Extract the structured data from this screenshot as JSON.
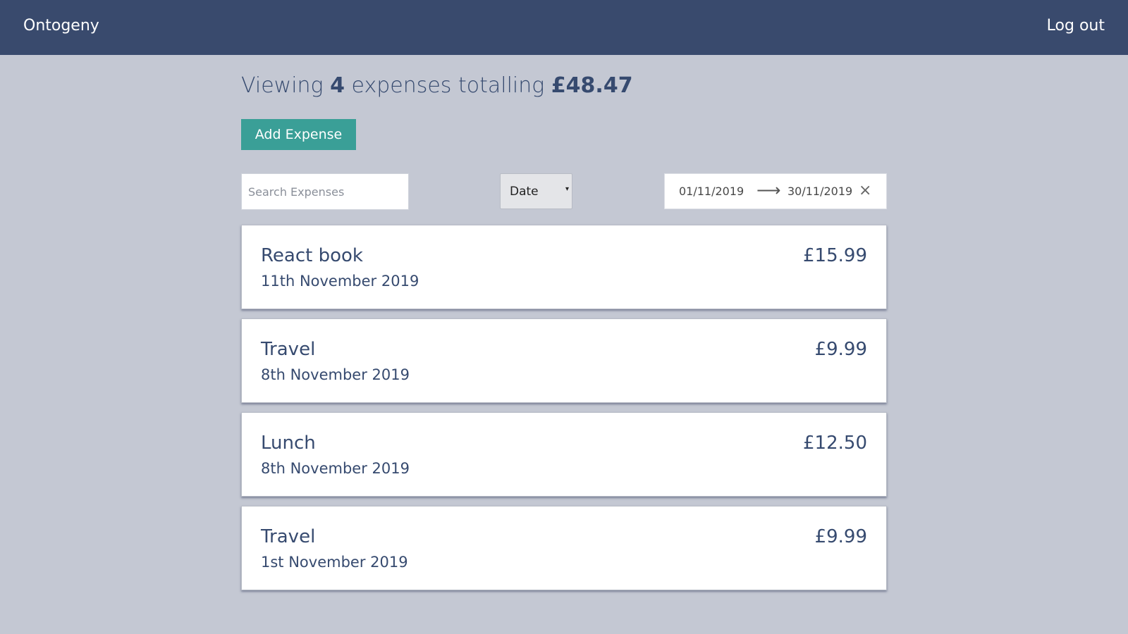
{
  "header": {
    "brand": "Ontogeny",
    "logout_label": "Log out"
  },
  "summary": {
    "prefix": "Viewing",
    "count": "4",
    "middle": "expenses totalling",
    "total": "£48.47"
  },
  "actions": {
    "add_label": "Add Expense"
  },
  "filters": {
    "search_placeholder": "Search Expenses",
    "search_value": "",
    "sort_selected": "Date",
    "sort_arrow": "▾",
    "start_date": "01/11/2019",
    "arrow": "⟶",
    "end_date": "30/11/2019",
    "clear_symbol": "×"
  },
  "expenses": [
    {
      "description": "React book",
      "date": "11th November 2019",
      "amount": "£15.99"
    },
    {
      "description": "Travel",
      "date": "8th November 2019",
      "amount": "£9.99"
    },
    {
      "description": "Lunch",
      "date": "8th November 2019",
      "amount": "£12.50"
    },
    {
      "description": "Travel",
      "date": "1st November 2019",
      "amount": "£9.99"
    }
  ],
  "colors": {
    "header_bg": "#394a6d",
    "page_bg": "#c4c8d3",
    "accent": "#3a9f97",
    "text": "#364a6f"
  }
}
